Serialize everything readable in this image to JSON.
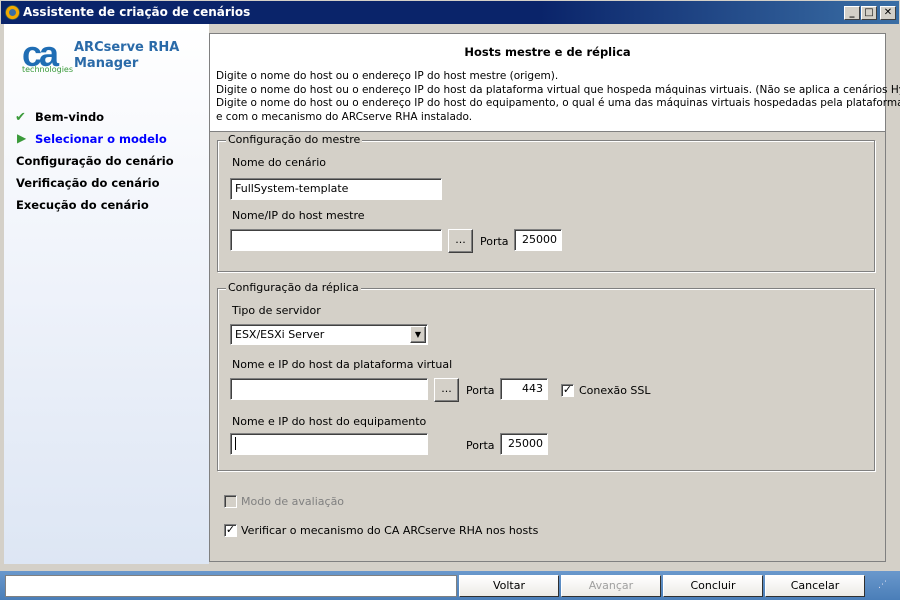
{
  "window": {
    "title": "Assistente de criação de cenários",
    "min": "_",
    "max": "□",
    "close": "✕"
  },
  "brand": {
    "logo": "ca",
    "logo_sub": "technologies",
    "product": "ARCserve RHA Manager"
  },
  "steps": [
    {
      "label": "Bem-vindo",
      "state": "done"
    },
    {
      "label": "Selecionar o modelo",
      "state": "current"
    },
    {
      "label": "Configuração do cenário",
      "state": "pending"
    },
    {
      "label": "Verificação do cenário",
      "state": "pending"
    },
    {
      "label": "Execução do cenário",
      "state": "pending"
    }
  ],
  "header": {
    "title": "Hosts mestre e de réplica",
    "text": "Digite o nome do host ou o endereço IP do host mestre (origem).\nDigite o nome do host ou o endereço IP do host da plataforma virtual que hospeda máquinas virtuais. (Não se aplica a cenários Hyper-V.)\nDigite o nome do host ou o endereço IP do host do equipamento, o qual é uma das máquinas virtuais hospedadas pela plataforma virtual\ne com o mecanismo do ARCserve RHA instalado."
  },
  "master": {
    "legend": "Configuração do mestre",
    "scenario_label": "Nome do cenário",
    "scenario_value": "FullSystem-template",
    "host_label": "Nome/IP do host mestre",
    "host_value": "",
    "browse": "...",
    "port_label": "Porta",
    "port_value": "25000"
  },
  "replica": {
    "legend": "Configuração da réplica",
    "server_type_label": "Tipo de servidor",
    "server_type_value": "ESX/ESXi Server",
    "vp_label": "Nome e IP do host da plataforma virtual",
    "vp_value": "",
    "browse": "...",
    "vp_port_label": "Porta",
    "vp_port_value": "443",
    "ssl_label": "Conexão SSL",
    "ssl_checked": true,
    "appliance_label": "Nome e IP do host do equipamento",
    "appliance_value": "",
    "appliance_port_label": "Porta",
    "appliance_port_value": "25000"
  },
  "options": {
    "eval_label": "Modo de avaliação",
    "eval_checked": false,
    "verify_label": "Verificar o mecanismo do CA ARCserve RHA nos hosts",
    "verify_checked": true
  },
  "buttons": {
    "back": "Voltar",
    "next": "Avançar",
    "finish": "Concluir",
    "cancel": "Cancelar"
  },
  "status": {
    "text": ""
  }
}
